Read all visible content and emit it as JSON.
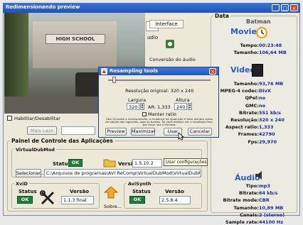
{
  "window_title": "Redimensionando preview",
  "left": {
    "tab_interface": "Interface",
    "audio_tab": "udio",
    "conv_audio": "Conversão do áudio",
    "enable_label": "Habilitar/Desabilitar",
    "about_btn": "Mais Lazo",
    "sign": "HIGH SCHOOL"
  },
  "panel": {
    "title": "Painel de Controle das Aplicações",
    "vdub_title": "VirtualDubMod",
    "status_label": "Status",
    "ok": "OK",
    "versao_label": "Versão",
    "vdub_version": "1.5.10.2",
    "select_btn": "Selecionar...",
    "path": "C:\\Arquivos de programas\\AVI ReComp\\VirtualDubMod\\VirtualDubMod.exe",
    "xvid_title": "XviD",
    "xvid_version": "1.1.3 final",
    "sobre_btn": "Sobre...",
    "avisynth_title": "AviSynth",
    "avisynth_version": "2.5.8.4",
    "tooltip": "Usar configurações específicas."
  },
  "dialog": {
    "title": "Resampling tools",
    "original": "Resolução original: 320 x 240",
    "width_label": "Largura",
    "width_val": "320",
    "ar": "AR: 1,333",
    "height_label": "Altura",
    "height_val": "240",
    "keep_ratio": "Manter ratio",
    "note": "Obs! Durante a recompressão, a mudança da resolução é feita sempre antes da adição das legendas, logo os bordas. Se você desejar ver o resultado final, por favor use o Preview.",
    "preview_btn": "Preview",
    "max_btn": "Maximizar",
    "use_btn": "Usar",
    "cancel_btn": "Cancelar"
  },
  "data": {
    "header": "Data",
    "filename": "Batman",
    "movie_title": "Movie",
    "movie_rows": [
      {
        "label": "Tempo:",
        "value": "00:23:48"
      },
      {
        "label": "Tamanho:",
        "value": "106,64 MB"
      }
    ],
    "video_title": "Video",
    "video_rows": [
      {
        "label": "Tamanho:",
        "value": "93,76 MB"
      },
      {
        "label": "MPEG-4 codec:",
        "value": "DivX"
      },
      {
        "label": "QPel:",
        "value": "no"
      },
      {
        "label": "GMC:",
        "value": "no"
      },
      {
        "label": "Bitrate:",
        "value": "551 kb/s"
      },
      {
        "label": "Resolução:",
        "value": "320 x 240"
      },
      {
        "label": "Aspect ratio:",
        "value": "1,333"
      },
      {
        "label": "Frames:",
        "value": "42790"
      },
      {
        "label": "Fps:",
        "value": "29,970"
      }
    ],
    "audio_title": "Áudio",
    "audio_rows": [
      {
        "label": "Tipo:",
        "value": "mp3"
      },
      {
        "label": "Bitrate:",
        "value": "64 kb/s"
      },
      {
        "label": "Bitrate mode:",
        "value": "CBR"
      },
      {
        "label": "Tamanho:",
        "value": "10,89 MB"
      },
      {
        "label": "Canais:",
        "value": "2 (stereo)"
      },
      {
        "label": "Sample rate:",
        "value": "44100 Hz"
      }
    ]
  }
}
